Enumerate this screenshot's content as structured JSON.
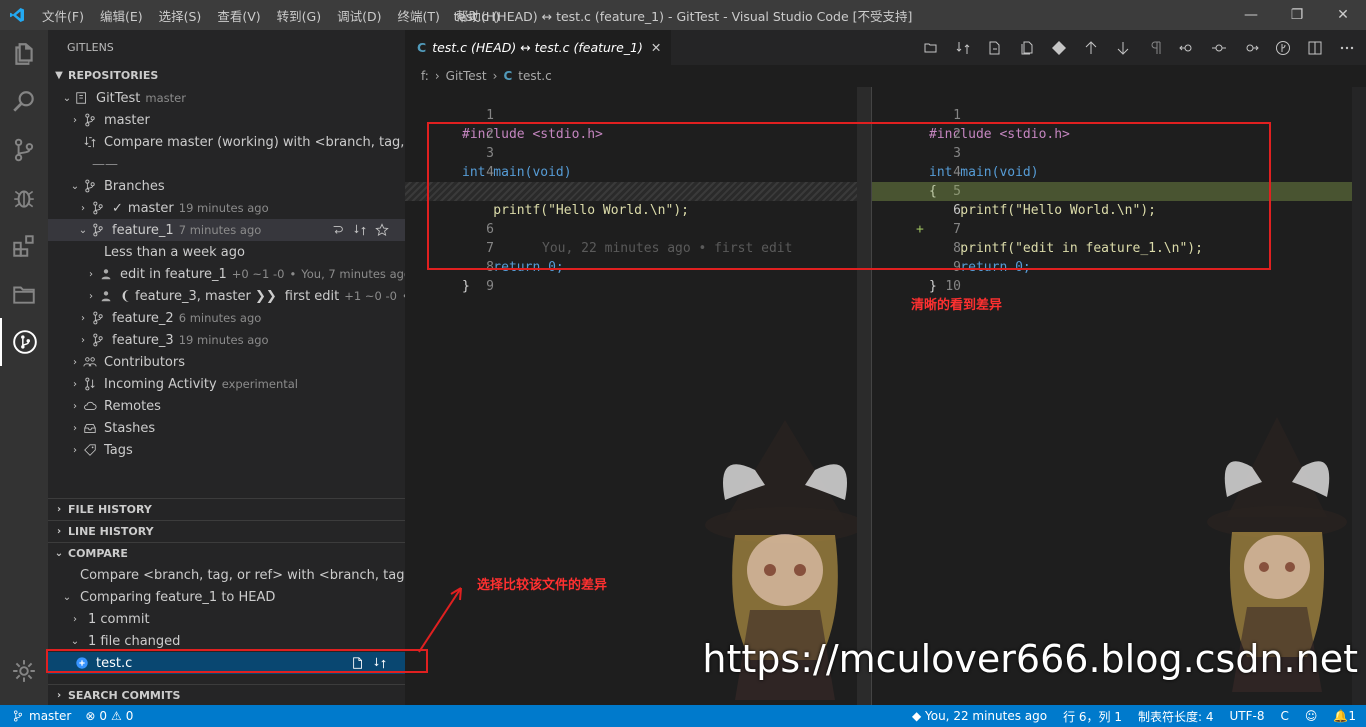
{
  "titlebar": {
    "menus": [
      "文件(F)",
      "编辑(E)",
      "选择(S)",
      "查看(V)",
      "转到(G)",
      "调试(D)",
      "终端(T)",
      "帮助(H)"
    ],
    "title": "test.c (HEAD) ↔ test.c (feature_1) - GitTest - Visual Studio Code [不受支持]",
    "minimize": "—",
    "maximize": "❐",
    "close": "✕"
  },
  "sidebar": {
    "title": "GITLENS",
    "repositories_header": "REPOSITORIES",
    "repo": {
      "name": "GitTest",
      "branch": "master"
    },
    "master_label": "master",
    "compare_working": "Compare master (working) with <branch, tag, o...",
    "divider": "——",
    "branches_label": "Branches",
    "branches": [
      {
        "check": "✓",
        "name": "master",
        "time": "19 minutes ago"
      },
      {
        "name": "feature_1",
        "time": "7 minutes ago"
      },
      {
        "name": "feature_2",
        "time": "6 minutes ago"
      },
      {
        "name": "feature_3",
        "time": "19 minutes ago"
      }
    ],
    "less_than_week": "Less than a week ago",
    "commits": [
      {
        "message": "edit in feature_1",
        "stats": "+0 ~1 -0",
        "sep": "•",
        "author": "You, 7 minutes ago"
      },
      {
        "refs": "❨ feature_3, master ❯❯",
        "message": "first edit",
        "stats": "+1 ~0 -0",
        "sep": "•",
        "more": "..."
      }
    ],
    "contributors": "Contributors",
    "incoming": {
      "label": "Incoming Activity",
      "tag": "experimental"
    },
    "remotes": "Remotes",
    "stashes": "Stashes",
    "tags": "Tags",
    "file_history": "FILE HISTORY",
    "line_history": "LINE HISTORY",
    "compare_header": "COMPARE",
    "compare_prompt": "Compare <branch, tag, or ref> with <branch, tag, or ...",
    "comparing": "Comparing feature_1 to HEAD",
    "commit_count": "1 commit",
    "files_changed": "1 file changed",
    "file": "test.c",
    "search_commits": "SEARCH COMMITS"
  },
  "editor": {
    "tab": {
      "icon": "C",
      "label": "test.c (HEAD) ↔ test.c (feature_1)",
      "close": "✕"
    },
    "breadcrumb": {
      "drive": "f:",
      "folder": "GitTest",
      "icon": "C",
      "file": "test.c",
      "sep": "›"
    },
    "left_lines": [
      {
        "n": "1",
        "text": "#include <stdio.h>"
      },
      {
        "n": "2",
        "text": ""
      },
      {
        "n": "3",
        "text": "int main(void)"
      },
      {
        "n": "4",
        "text": "{"
      },
      {
        "n": "5",
        "text": "    printf(\"Hello World.\\n\");"
      },
      {
        "n": "6",
        "text": ""
      },
      {
        "n": "7",
        "text": "    return 0;"
      },
      {
        "n": "8",
        "text": "}"
      },
      {
        "n": "9",
        "text": ""
      }
    ],
    "blame": "You, 22 minutes ago • first edit",
    "right_lines": [
      {
        "n": "1",
        "text": "#include <stdio.h>"
      },
      {
        "n": "2",
        "text": ""
      },
      {
        "n": "3",
        "text": "int main(void)"
      },
      {
        "n": "4",
        "text": "{"
      },
      {
        "n": "5",
        "text": "    printf(\"Hello World.\\n\");"
      },
      {
        "n": "6",
        "text": "    printf(\"edit in feature_1.\\n\");"
      },
      {
        "n": "7",
        "text": ""
      },
      {
        "n": "8",
        "text": "    return 0;"
      },
      {
        "n": "9",
        "text": "}"
      },
      {
        "n": "10",
        "text": ""
      }
    ],
    "added_marker": "+"
  },
  "annotations": {
    "diff_note": "清晰的看到差异",
    "select_note": "选择比较该文件的差异",
    "watermark": "https://mculover666.blog.csdn.net"
  },
  "statusbar": {
    "branch": "master",
    "errors": "0",
    "warnings": "0",
    "blame": "You, 22 minutes ago",
    "position": "行 6，列 1",
    "tab_size": "制表符长度: 4",
    "encoding": "UTF-8",
    "language": "C",
    "notifications": "1"
  },
  "colors": {
    "accent": "#007acc",
    "highlight_box": "#e02020",
    "added_line": "#4b5a2a",
    "selection": "#094771"
  }
}
